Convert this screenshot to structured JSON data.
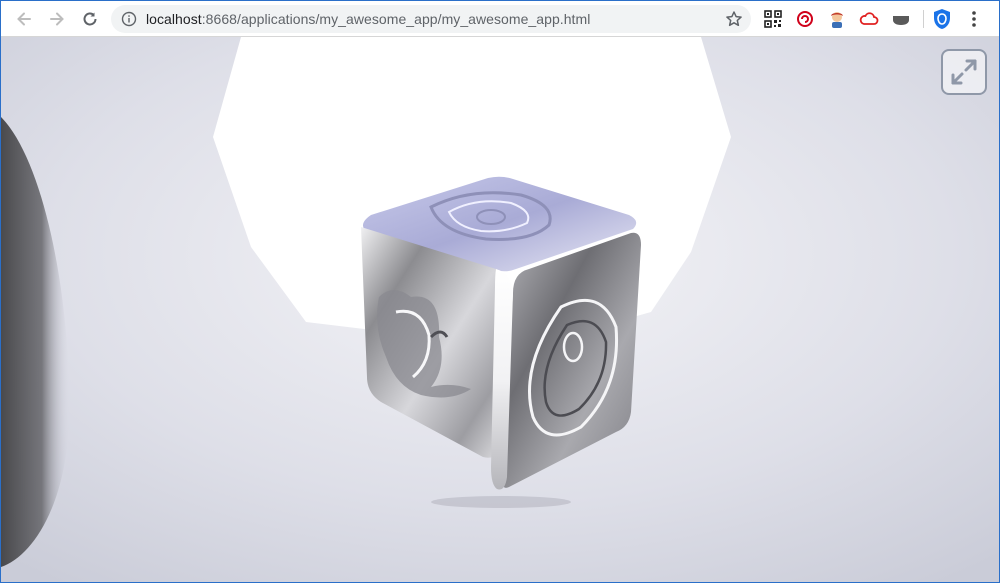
{
  "browser": {
    "url_host": "localhost",
    "url_rest": ":8668/applications/my_awesome_app/my_awesome_app.html",
    "nav": {
      "back_icon": "arrow-left-icon",
      "forward_icon": "arrow-right-icon",
      "reload_icon": "reload-icon"
    },
    "extensions": [
      "qr-code-icon",
      "circle-arrow-icon",
      "avatar-icon",
      "cloud-icon",
      "dark-shape-icon",
      "shield-icon"
    ],
    "colors": {
      "accent": "#2a6fc9",
      "toolbar": "#ffffff",
      "omnibox": "#f1f3f4"
    }
  },
  "scene": {
    "object": "chrome-cube",
    "background": "#dcdce6",
    "fullscreen_icon": "expand-arrows-icon"
  }
}
